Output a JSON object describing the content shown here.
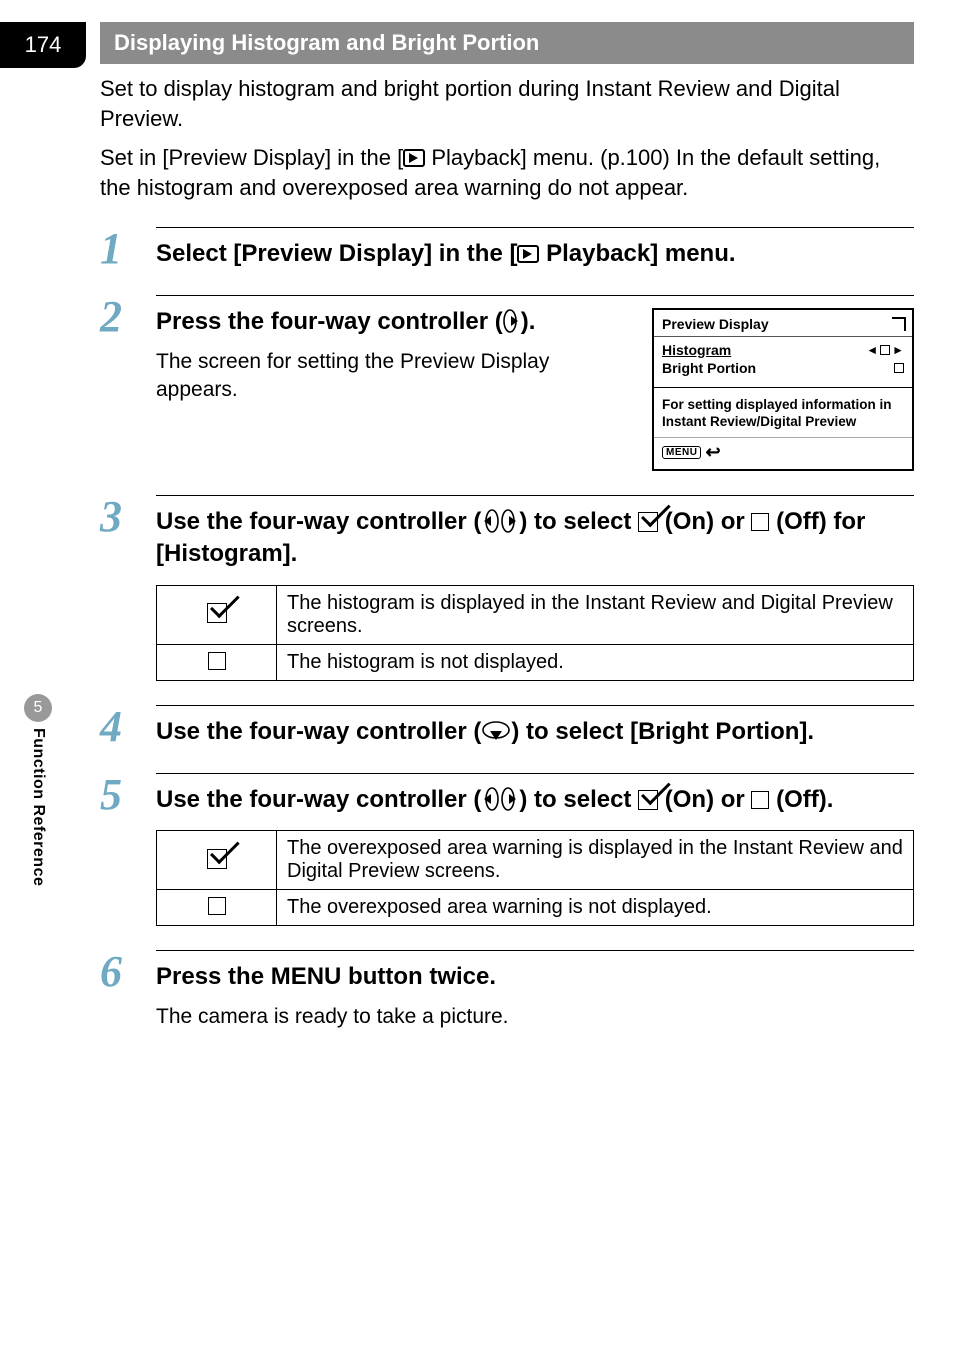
{
  "page_number": "174",
  "sidebar": {
    "chapter_num": "5",
    "chapter_title": "Function Reference"
  },
  "section_title": "Displaying Histogram and Bright Portion",
  "intro": {
    "p1": "Set to display histogram and bright portion during Instant Review and Digital Preview.",
    "p2a": "Set in [Preview Display] in the [",
    "p2b": " Playback] menu. (p.100) In the default setting, the histogram and overexposed area warning do not appear."
  },
  "steps": {
    "s1": {
      "num": "1",
      "title_a": "Select [Preview Display] in the [",
      "title_b": " Playback] menu."
    },
    "s2": {
      "num": "2",
      "title_a": "Press the four-way controller (",
      "title_b": ").",
      "desc": "The screen for setting the Preview Display appears."
    },
    "s3": {
      "num": "3",
      "title_a": "Use the four-way controller (",
      "title_b": ") to select ",
      "title_c": " (On) or ",
      "title_d": " (Off) for [Histogram]."
    },
    "s4": {
      "num": "4",
      "title_a": "Use the four-way controller (",
      "title_b": ") to select [Bright Portion]."
    },
    "s5": {
      "num": "5",
      "title_a": "Use the four-way controller (",
      "title_b": ") to select ",
      "title_c": " (On) or ",
      "title_d": " (Off)."
    },
    "s6": {
      "num": "6",
      "title": "Press the MENU button twice.",
      "desc": "The camera is ready to take a picture."
    }
  },
  "lcd": {
    "title": "Preview Display",
    "row1": "Histogram",
    "row2": "Bright Portion",
    "info": "For setting displayed information in Instant Review/Digital Preview",
    "menu": "MENU"
  },
  "table_hist": {
    "on": "The histogram is displayed in the Instant Review and Digital Preview screens.",
    "off": "The histogram is not displayed."
  },
  "table_bright": {
    "on": "The overexposed area warning is displayed in the Instant Review and Digital Preview screens.",
    "off": "The overexposed area warning is not displayed."
  }
}
